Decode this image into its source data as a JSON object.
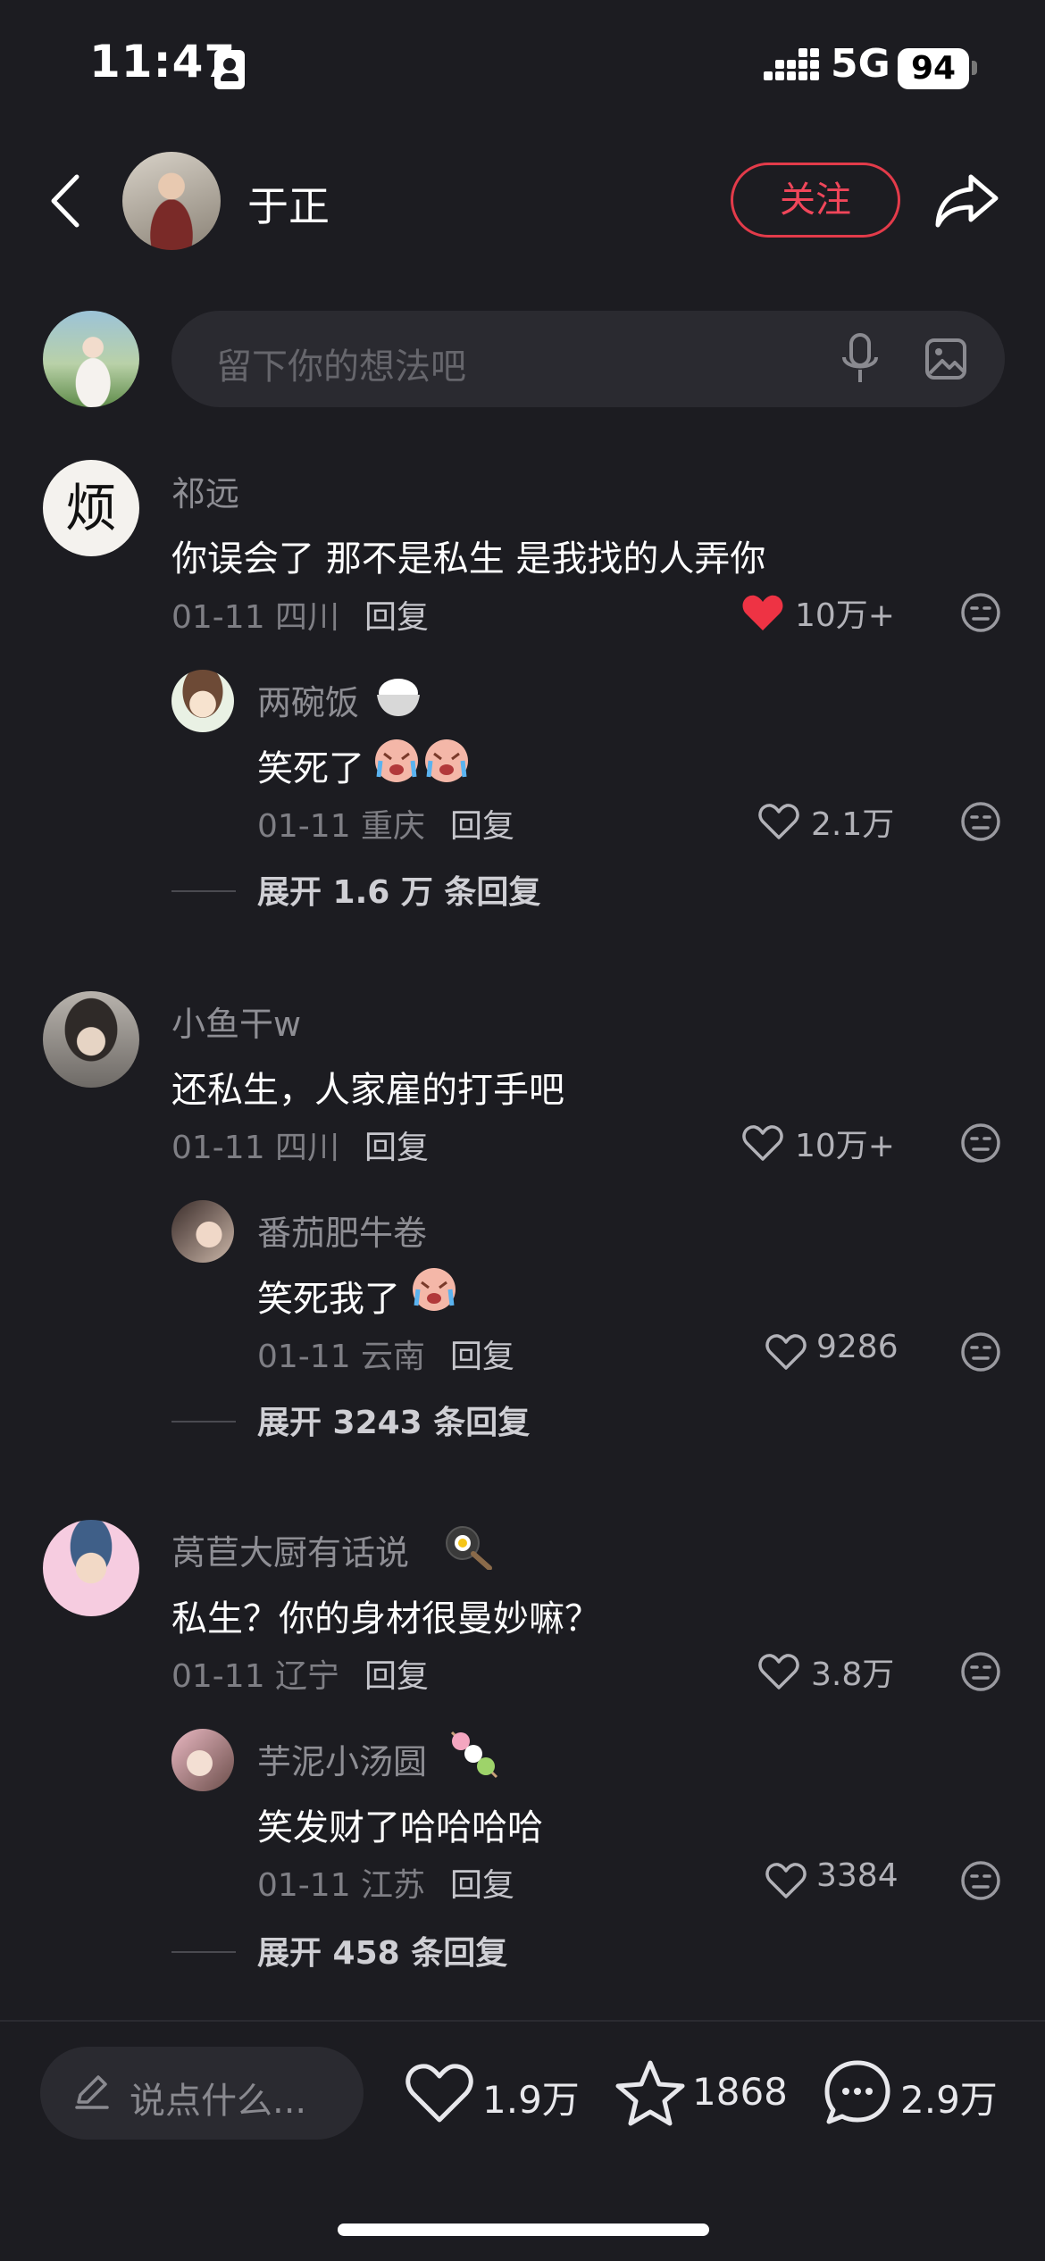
{
  "status_bar": {
    "time": "11:47",
    "network": "5G",
    "battery": "94"
  },
  "header": {
    "author_name": "于正",
    "follow_label": "关注"
  },
  "composer": {
    "placeholder": "留下你的想法吧"
  },
  "comments": [
    {
      "name": "祁远",
      "avatar_text": "烦",
      "text": "你误会了 那不是私生 是我找的人弄你",
      "date_location": "01-11 四川",
      "reply_label": "回复",
      "likes": "10万+",
      "liked": true,
      "reply": {
        "name": "两碗饭",
        "text": "笑死了",
        "date_location": "01-11 重庆",
        "reply_label": "回复",
        "likes": "2.1万"
      },
      "expand": "展开 1.6 万 条回复"
    },
    {
      "name": "小鱼干w",
      "text": "还私生，人家雇的打手吧",
      "date_location": "01-11 四川",
      "reply_label": "回复",
      "likes": "10万+",
      "liked": false,
      "reply": {
        "name": "番茄肥牛卷",
        "text": "笑死我了",
        "date_location": "01-11 云南",
        "reply_label": "回复",
        "likes": "9286"
      },
      "expand": "展开 3243 条回复"
    },
    {
      "name": "莴苣大厨有话说",
      "text": "私生？你的身材很曼妙嘛？",
      "date_location": "01-11 辽宁",
      "reply_label": "回复",
      "likes": "3.8万",
      "liked": false,
      "reply": {
        "name": "芋泥小汤圆",
        "text": "笑发财了哈哈哈哈",
        "date_location": "01-11 江苏",
        "reply_label": "回复",
        "likes": "3384"
      },
      "expand": "展开 458 条回复"
    }
  ],
  "bottom_bar": {
    "placeholder": "说点什么...",
    "likes": "1.9万",
    "favorites": "1868",
    "comments": "2.9万"
  },
  "colors": {
    "accent": "#f0465a",
    "background": "#1c1c21",
    "liked_heart": "#ee3344"
  }
}
